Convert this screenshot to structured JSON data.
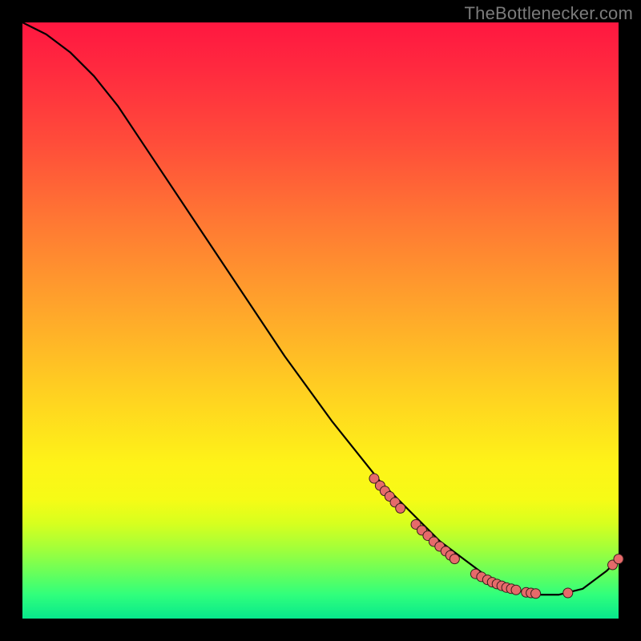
{
  "watermark": "TheBottlenecker.com",
  "chart_data": {
    "type": "line",
    "title": "",
    "xlabel": "",
    "ylabel": "",
    "xlim": [
      0,
      100
    ],
    "ylim": [
      0,
      100
    ],
    "grid": false,
    "legend": false,
    "series": [
      {
        "name": "curve",
        "x": [
          0,
          4,
          8,
          12,
          16,
          20,
          28,
          36,
          44,
          52,
          60,
          66,
          70,
          74,
          78,
          82,
          86,
          90,
          94,
          98,
          100
        ],
        "y": [
          100,
          98,
          95,
          91,
          86,
          80,
          68,
          56,
          44,
          33,
          23,
          17,
          13,
          10,
          7,
          5,
          4,
          4,
          5,
          8,
          10
        ]
      }
    ],
    "markers": [
      {
        "x": 59.0,
        "y": 23.5
      },
      {
        "x": 60.0,
        "y": 22.3
      },
      {
        "x": 60.8,
        "y": 21.4
      },
      {
        "x": 61.6,
        "y": 20.5
      },
      {
        "x": 62.5,
        "y": 19.5
      },
      {
        "x": 63.4,
        "y": 18.5
      },
      {
        "x": 66.0,
        "y": 15.8
      },
      {
        "x": 67.0,
        "y": 14.8
      },
      {
        "x": 68.0,
        "y": 13.9
      },
      {
        "x": 69.0,
        "y": 12.9
      },
      {
        "x": 70.0,
        "y": 12.1
      },
      {
        "x": 71.0,
        "y": 11.3
      },
      {
        "x": 71.8,
        "y": 10.6
      },
      {
        "x": 72.5,
        "y": 10.0
      },
      {
        "x": 76.0,
        "y": 7.5
      },
      {
        "x": 77.0,
        "y": 7.0
      },
      {
        "x": 78.0,
        "y": 6.5
      },
      {
        "x": 78.8,
        "y": 6.1
      },
      {
        "x": 79.6,
        "y": 5.8
      },
      {
        "x": 80.4,
        "y": 5.5
      },
      {
        "x": 81.2,
        "y": 5.2
      },
      {
        "x": 82.0,
        "y": 5.0
      },
      {
        "x": 82.8,
        "y": 4.8
      },
      {
        "x": 84.5,
        "y": 4.4
      },
      {
        "x": 85.3,
        "y": 4.3
      },
      {
        "x": 86.1,
        "y": 4.2
      },
      {
        "x": 91.5,
        "y": 4.3
      },
      {
        "x": 99.0,
        "y": 9.0
      },
      {
        "x": 100.0,
        "y": 10.0
      }
    ],
    "colors": {
      "curve": "#000000",
      "marker_fill": "#e66a6a",
      "marker_stroke": "#3a1d1d"
    },
    "marker_radius_px": 6
  }
}
